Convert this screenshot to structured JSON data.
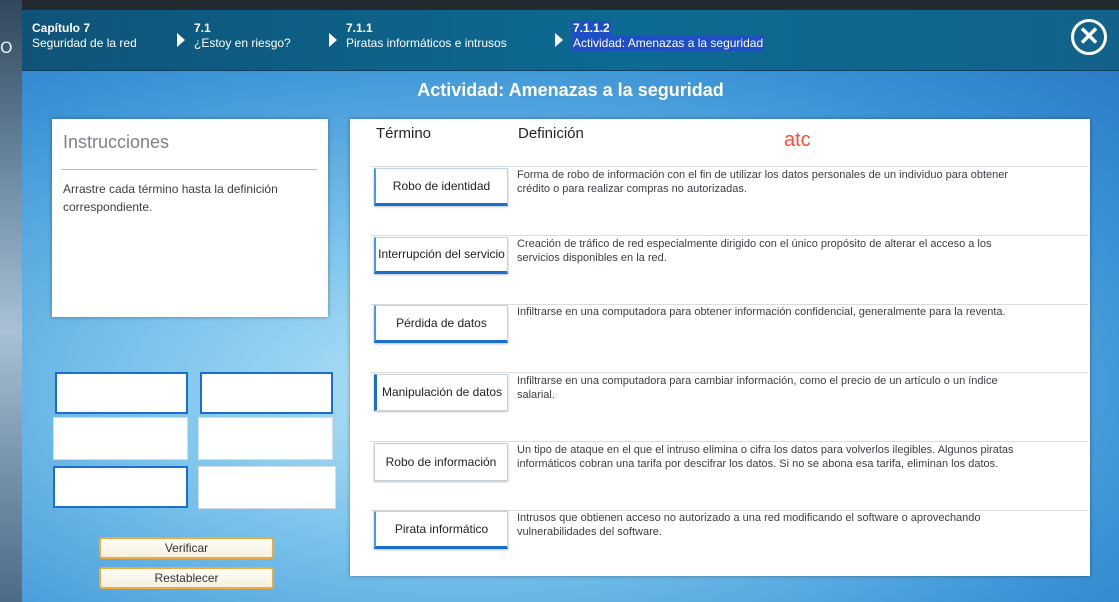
{
  "header": {
    "crumbs": [
      {
        "num": "Capítulo 7",
        "text": "Seguridad de la red"
      },
      {
        "num": "7.1",
        "text": "¿Estoy en riesgo?"
      },
      {
        "num": "7.1.1",
        "text": "Piratas informáticos e intrusos"
      },
      {
        "num": "7.1.1.2",
        "text": "Actividad: Amenazas a la seguridad"
      }
    ],
    "close_icon": "close-icon"
  },
  "left_strip_text": "O",
  "main": {
    "title": "Actividad: Amenazas a la seguridad"
  },
  "instructions": {
    "title": "Instrucciones",
    "text": "Arrastre cada término hasta la definición correspondiente."
  },
  "buttons": {
    "verify": "Verificar",
    "reset": "Restablecer"
  },
  "table": {
    "term_header": "Término",
    "definition_header": "Definición",
    "annotation": "atc",
    "rows": [
      {
        "term": "Robo de identidad",
        "definition": "Forma de robo de información con el fin de utilizar los datos personales de un individuo para obtener crédito o para realizar compras no autorizadas."
      },
      {
        "term": "Interrupción del servicio",
        "definition": "Creación de tráfico de red especialmente dirigido con el único propósito de alterar el acceso a los servicios disponibles en la red."
      },
      {
        "term": "Pérdida de datos",
        "definition": "Infiltrarse en una computadora para obtener información confidencial, generalmente para la reventa."
      },
      {
        "term": "Manipulación de datos",
        "definition": "Infiltrarse en una computadora para cambiar información, como el precio de un artículo o un índice salarial."
      },
      {
        "term": "Robo de información",
        "definition": "Un tipo de ataque en el que el intruso elimina o cifra los datos para volverlos ilegibles. Algunos piratas informáticos cobran una tarifa por descifrar los datos. Si no se abona esa tarifa, eliminan los datos."
      },
      {
        "term": "Pirata informático",
        "definition": "Intrusos que obtienen acceso no autorizado a una red modificando el software o aprovechando vulnerabilidades del software."
      }
    ]
  },
  "colors": {
    "header": "#0d6a92",
    "accent_blue": "#1a6fce",
    "button_border": "#f1a93a",
    "annotation_red": "#ff4b3a"
  }
}
